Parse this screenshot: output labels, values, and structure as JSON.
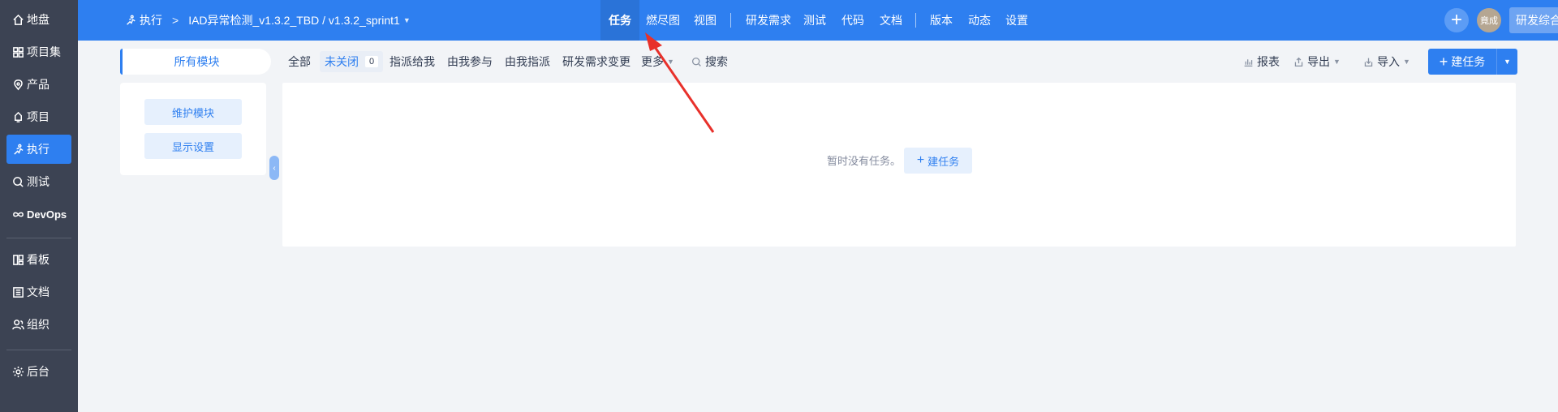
{
  "sidebar": {
    "items": [
      {
        "label": "地盘",
        "icon": "home-icon"
      },
      {
        "label": "项目集",
        "icon": "grid-icon"
      },
      {
        "label": "产品",
        "icon": "product-icon"
      },
      {
        "label": "项目",
        "icon": "project-icon"
      },
      {
        "label": "执行",
        "icon": "run-icon",
        "active": true
      },
      {
        "label": "测试",
        "icon": "search-test-icon"
      },
      {
        "label": "DevOps",
        "icon": "infinity-icon"
      },
      {
        "label": "看板",
        "icon": "kanban-icon"
      },
      {
        "label": "文档",
        "icon": "doc-icon"
      },
      {
        "label": "组织",
        "icon": "users-icon"
      },
      {
        "label": "后台",
        "icon": "gear-icon"
      }
    ]
  },
  "topbar": {
    "breadcrumb_root": "执行",
    "breadcrumb_sep": ">",
    "breadcrumb_current": "IAD异常检测_v1.3.2_TBD / v1.3.2_sprint1",
    "nav": [
      "任务",
      "燃尽图",
      "视图",
      "研发需求",
      "测试",
      "代码",
      "文档",
      "版本",
      "动态",
      "设置"
    ],
    "active_nav": "任务",
    "plus": "+",
    "avatar_text": "竟成",
    "rd_button": "研发综合界面",
    "accent_color": "#2e7ff0"
  },
  "module": {
    "tab_label": "所有模块",
    "maintain_button": "维护模块",
    "display_button": "显示设置"
  },
  "filters": {
    "all": "全部",
    "unclosed": "未关闭",
    "unclosed_count": "0",
    "assigned_to_me": "指派给我",
    "involved": "由我参与",
    "assigned_by_me": "由我指派",
    "story_changed": "研发需求变更",
    "more": "更多",
    "search": "搜索"
  },
  "actions": {
    "report": "报表",
    "export": "导出",
    "import": "导入",
    "create_task": "建任务",
    "create_task_plus": "+"
  },
  "content": {
    "empty_text": "暂时没有任务。",
    "empty_button": "建任务",
    "empty_button_plus": "+"
  }
}
